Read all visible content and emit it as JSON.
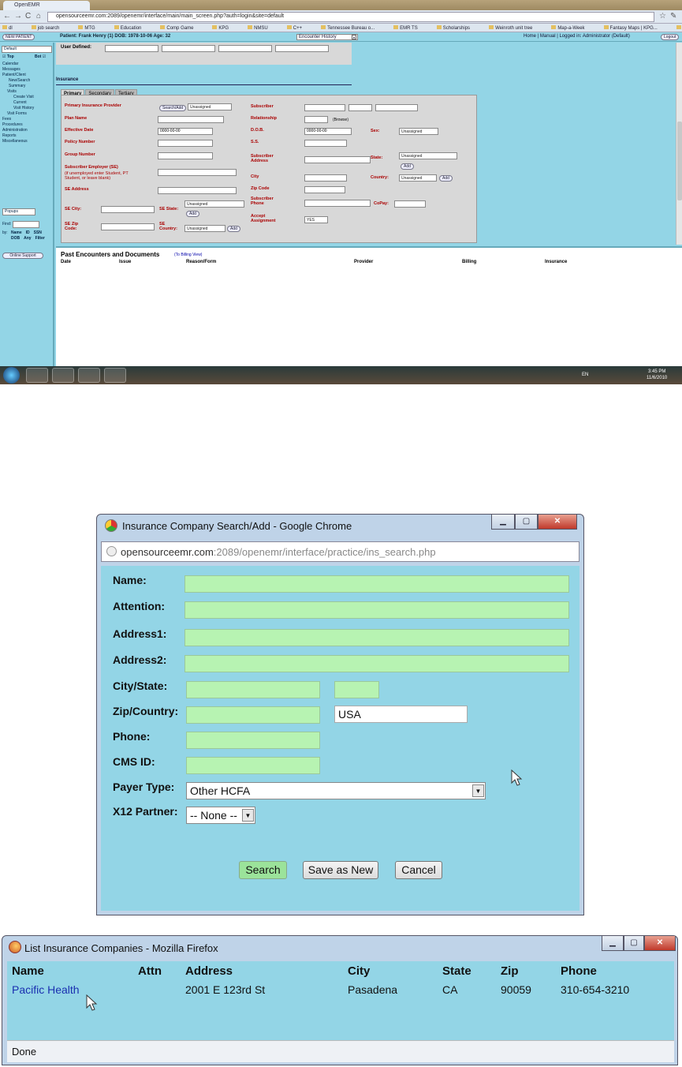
{
  "screen1": {
    "tab_title": "OpenEMR",
    "url": "opensourceemr.com:2089/openemr/interface/main/main_screen.php?auth=login&site=default",
    "bookmarks": [
      "dl",
      "job search",
      "MTG",
      "Education",
      "Comp Game",
      "KPG",
      "NMSU",
      "C++",
      "Tennessee Bureau o...",
      "EMR TS",
      "Scholarships",
      "Weinroth unit tree",
      "Map-a-Week",
      "Fantasy Maps | KPG...",
      "Other bookmarks"
    ],
    "header": {
      "new_patient": "NEW PATIENT",
      "patient_info": "Patient: Frank Henry (1) DOB: 1978-10-06 Age: 32",
      "encounter_history": "Encounter History",
      "right_links": "Home | Manual | Logged in: Administrator (Default)",
      "logout": "Logout"
    },
    "leftnav": {
      "default_select": "Default",
      "top": "Top",
      "bot": "Bot",
      "items": [
        "Calendar",
        "Messages",
        "Patient/Client",
        "New/Search",
        "Summary",
        "Visits",
        "Create Visit",
        "Current",
        "Visit History",
        "Visit Forms",
        "Fees",
        "Procedures",
        "Administration",
        "Reports",
        "Miscellaneous"
      ],
      "popups": "Popups",
      "find_label": "Find:",
      "by_label": "by:",
      "find_opts": [
        "Name",
        "ID",
        "SSN",
        "DOB",
        "Any",
        "Filter"
      ],
      "online_support": "Online Support"
    },
    "main": {
      "user_defined": "User Defined:",
      "insurance": "Insurance",
      "tabs": [
        "Primary",
        "Secondary",
        "Tertiary"
      ],
      "left_labels": [
        "Primary Insurance Provider",
        "Plan Name",
        "Effective Date",
        "Policy Number",
        "Group Number",
        "Subscriber Employer (SE)",
        "(if unemployed enter Student, PT Student, or leave blank)",
        "SE Address",
        "SE City:",
        "SE State:",
        "SE Zip Code:",
        "SE Country:"
      ],
      "right_labels": [
        "Subscriber",
        "Relationship",
        "D.O.B.",
        "S.S.",
        "Subscriber Address",
        "City",
        "Zip Code",
        "Subscriber Phone",
        "Accept Assignment",
        "Sex:",
        "State:",
        "Country:",
        "CoPay:"
      ],
      "search_add": "Search/Add",
      "unassigned": "Unassigned",
      "date_val": "0000-00-00",
      "browse": "(Browse)",
      "add": "Add",
      "yes": "YES",
      "past_title": "Past Encounters and Documents",
      "billing_view": "(To Billing View)",
      "past_cols": [
        "Date",
        "Issue",
        "Reason/Form",
        "Provider",
        "Billing",
        "Insurance"
      ]
    },
    "taskbar": {
      "lang": "EN",
      "time": "3:45 PM",
      "date": "11/6/2010"
    }
  },
  "dialog1": {
    "title": "Insurance Company Search/Add - Google Chrome",
    "url_host": "opensourceemr.com",
    "url_path": ":2089/openemr/interface/practice/ins_search.php",
    "labels": {
      "name": "Name:",
      "attention": "Attention:",
      "address1": "Address1:",
      "address2": "Address2:",
      "citystate": "City/State:",
      "zipcountry": "Zip/Country:",
      "phone": "Phone:",
      "cmsid": "CMS ID:",
      "payer": "Payer Type:",
      "x12": "X12 Partner:"
    },
    "country_value": "USA",
    "payer_value": "Other HCFA",
    "x12_value": "-- None --",
    "buttons": {
      "search": "Search",
      "save_new": "Save as New",
      "cancel": "Cancel"
    }
  },
  "dialog2": {
    "title": "List Insurance Companies - Mozilla Firefox",
    "columns": [
      "Name",
      "Attn",
      "Address",
      "City",
      "State",
      "Zip",
      "Phone"
    ],
    "row": {
      "name": "Pacific Health",
      "attn": "",
      "address": "2001 E 123rd St",
      "city": "Pasadena",
      "state": "CA",
      "zip": "90059",
      "phone": "310-654-3210"
    },
    "status": "Done"
  }
}
